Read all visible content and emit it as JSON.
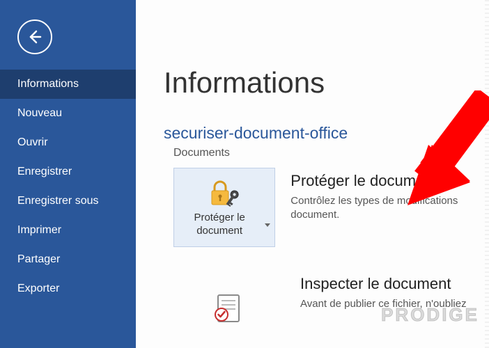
{
  "sidebar": {
    "items": [
      {
        "label": "Informations",
        "active": true
      },
      {
        "label": "Nouveau"
      },
      {
        "label": "Ouvrir"
      },
      {
        "label": "Enregistrer"
      },
      {
        "label": "Enregistrer sous"
      },
      {
        "label": "Imprimer"
      },
      {
        "label": "Partager"
      },
      {
        "label": "Exporter"
      }
    ]
  },
  "main": {
    "page_title": "Informations",
    "document_name": "securiser-document-office",
    "document_location": "Documents",
    "sections": [
      {
        "tile_label": "Protéger le document",
        "title": "Protéger le document",
        "desc": "Contrôlez les types de modifications document."
      },
      {
        "tile_label": "",
        "title": "Inspecter le document",
        "desc": "Avant de publier ce fichier, n'oubliez"
      }
    ]
  },
  "watermark": "PRODIGE",
  "colors": {
    "brand": "#2a579a",
    "sidebar_active": "#1e3e6e",
    "tile_bg": "#e6eef8",
    "annotation": "#ff0000"
  }
}
